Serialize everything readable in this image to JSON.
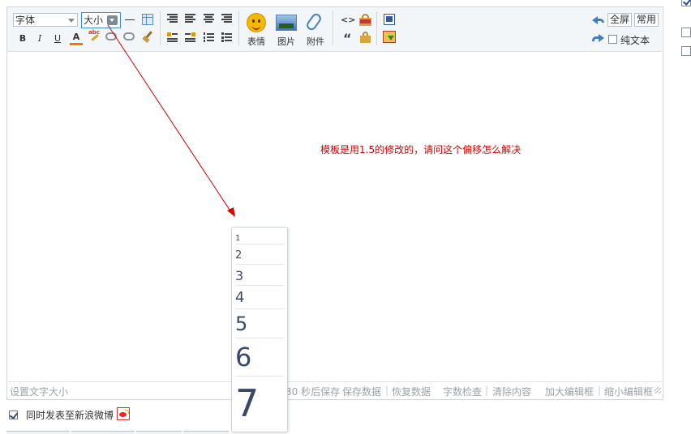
{
  "toolbar": {
    "font_select": "字体",
    "size_select": "大小",
    "smiley_label": "表情",
    "image_label": "图片",
    "attach_label": "附件",
    "fullscreen_label": "全屏",
    "common_label": "常用",
    "plaintext_label": "纯文本",
    "bold": "B",
    "italic": "I",
    "underline": "U",
    "fontcolor": "A",
    "quote": "“",
    "code": "<>",
    "highlight": "abc"
  },
  "content": {
    "message": "模板是用1.5的修改的，请问这个偏移怎么解决"
  },
  "status": {
    "hint": "设置文字大小",
    "autosave": "30 秒后保存",
    "save_data": "保存数据",
    "restore_data": "恢复数据",
    "word_check": "字数检查",
    "clear_content": "清除内容",
    "enlarge": "加大编辑框",
    "shrink": "缩小编辑框"
  },
  "size_options": [
    "1",
    "2",
    "3",
    "4",
    "5",
    "6",
    "7"
  ],
  "footer": {
    "weibo_label": "同时发表至新浪微博"
  },
  "colors": {
    "annotation_red": "#d40000",
    "accent_blue": "#2f6fb3"
  }
}
